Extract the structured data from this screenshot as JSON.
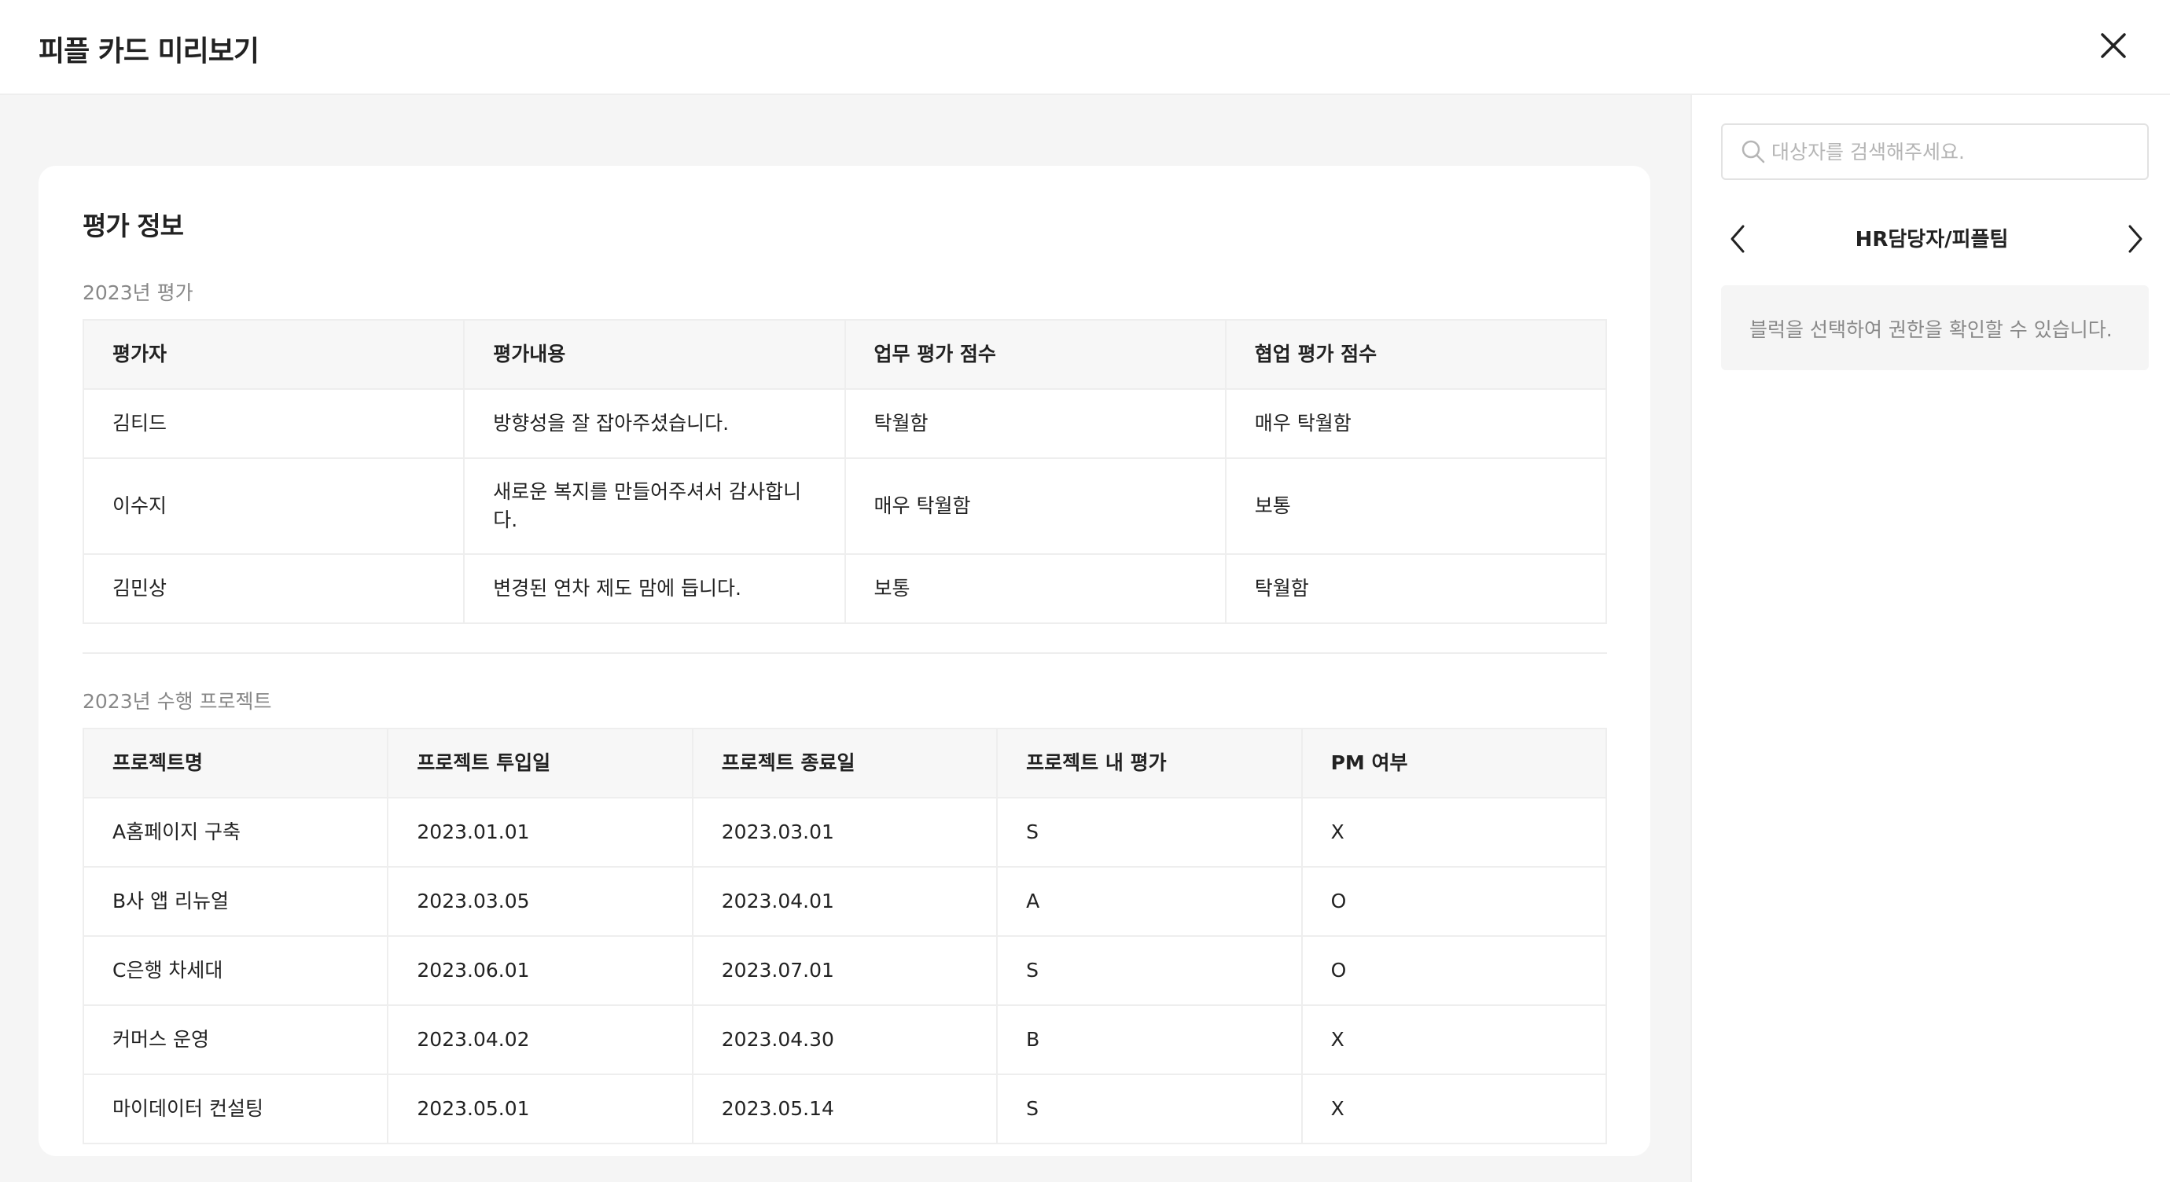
{
  "header": {
    "title": "피플 카드 미리보기",
    "close_icon": "close-icon"
  },
  "evaluation": {
    "title": "평가 정보",
    "review_section": {
      "label": "2023년 평가",
      "columns": [
        "평가자",
        "평가내용",
        "업무 평가 점수",
        "협업 평가 점수"
      ],
      "rows": [
        [
          "김티드",
          "방향성을 잘 잡아주셨습니다.",
          "탁월함",
          "매우 탁월함"
        ],
        [
          "이수지",
          "새로운 복지를 만들어주셔서 감사합니다.",
          "매우 탁월함",
          "보통"
        ],
        [
          "김민상",
          "변경된 연차 제도 맘에 듭니다.",
          "보통",
          "탁월함"
        ]
      ]
    },
    "project_section": {
      "label": "2023년 수행 프로젝트",
      "columns": [
        "프로젝트명",
        "프로젝트 투입일",
        "프로젝트 종료일",
        "프로젝트 내 평가",
        "PM 여부"
      ],
      "rows": [
        [
          "A홈페이지 구축",
          "2023.01.01",
          "2023.03.01",
          "S",
          "X"
        ],
        [
          "B사 앱 리뉴얼",
          "2023.03.05",
          "2023.04.01",
          "A",
          "O"
        ],
        [
          "C은행 차세대",
          "2023.06.01",
          "2023.07.01",
          "S",
          "O"
        ],
        [
          "커머스 운영",
          "2023.04.02",
          "2023.04.30",
          "B",
          "X"
        ],
        [
          "마이데이터 컨설팅",
          "2023.05.01",
          "2023.05.14",
          "S",
          "X"
        ]
      ]
    }
  },
  "sidebar": {
    "search": {
      "placeholder": "대상자를 검색해주세요.",
      "value": "",
      "icon": "search-icon"
    },
    "nav": {
      "title": "HR담당자/피플팀",
      "prev_icon": "chevron-left-icon",
      "next_icon": "chevron-right-icon"
    },
    "info_text": "블럭을 선택하여 권한을 확인할 수 있습니다."
  }
}
